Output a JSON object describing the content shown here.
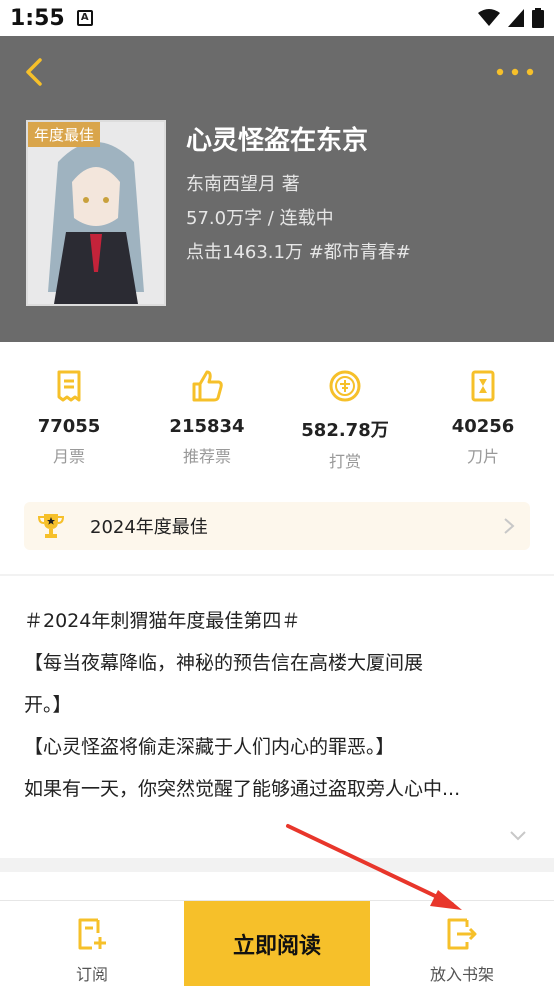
{
  "status_bar": {
    "time": "1:55",
    "notification_badge": "A"
  },
  "book": {
    "badge": "年度最佳",
    "title": "心灵怪盗在东京",
    "author": "东南西望月 著",
    "words_status": "57.0万字 / 连载中",
    "clicks_tag": "点击1463.1万  #都市青春#"
  },
  "stats": [
    {
      "value": "77055",
      "label": "月票",
      "icon": "ticket-icon"
    },
    {
      "value": "215834",
      "label": "推荐票",
      "icon": "thumbs-up-icon"
    },
    {
      "value": "582.78万",
      "label": "打赏",
      "icon": "reward-coin-icon"
    },
    {
      "value": "40256",
      "label": "刀片",
      "icon": "blade-icon"
    }
  ],
  "award": {
    "label": "2024年度最佳"
  },
  "intro": {
    "lines": [
      "＃2024年刺猬猫年度最佳第四＃",
      "【每当夜幕降临，神秘的预告信在高楼大厦间展",
      "开。】",
      "【心灵怪盗将偷走深藏于人们内心的罪恶。】",
      "如果有一天，你突然觉醒了能够通过盗取旁人心中..."
    ]
  },
  "bottom_bar": {
    "subscribe": "订阅",
    "read_now": "立即阅读",
    "add_shelf": "放入书架"
  },
  "colors": {
    "accent": "#f6c02a",
    "hero_bg": "#6b6b6b",
    "annotation_arrow": "#e8362b"
  }
}
